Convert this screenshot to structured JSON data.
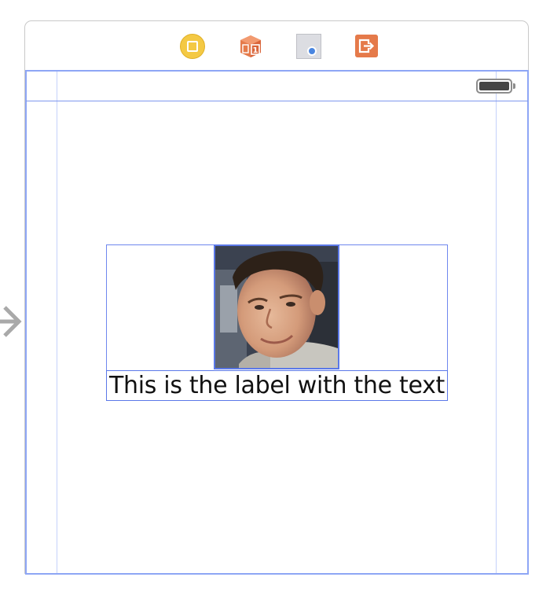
{
  "scene": {
    "dock_icons": [
      {
        "name": "view-controller-icon",
        "color": "#f4c944"
      },
      {
        "name": "first-responder-icon",
        "color": "#e57a4a"
      },
      {
        "name": "proxy-object-icon",
        "color": "#4a86e0"
      },
      {
        "name": "exit-icon",
        "color": "#e57a4a"
      }
    ],
    "battery_icon": "battery-icon",
    "entry_point_icon": "arrow-right-icon"
  },
  "content": {
    "label_text": "This is the label with the text"
  },
  "colors": {
    "selection_outline": "#6f87ee",
    "view_border": "#8ea6f5",
    "layout_guide": "#c5d1fa"
  }
}
